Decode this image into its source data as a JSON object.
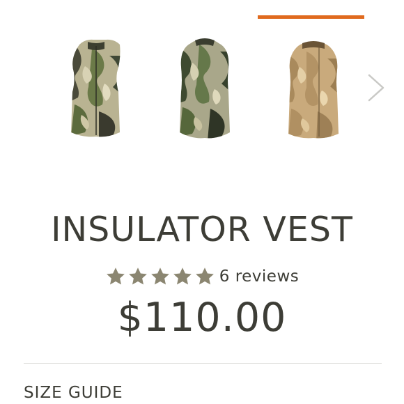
{
  "carousel": {
    "thumbnails": [
      {
        "alt": "Insulator Vest - green camo, front",
        "active": false,
        "pattern": "green-camo"
      },
      {
        "alt": "Insulator Vest - green camo, alternate",
        "active": false,
        "pattern": "green-camo"
      },
      {
        "alt": "Insulator Vest - desert camo",
        "active": true,
        "pattern": "desert-camo"
      }
    ],
    "next_icon": "chevron-right-icon",
    "active_color": "#e06a1e"
  },
  "product": {
    "title": "INSULATOR VEST",
    "rating": 5,
    "rating_max": 5,
    "star_icon": "star-icon",
    "star_color": "#8b8671",
    "reviews_label": "6 reviews",
    "price": "$110.00"
  },
  "size_guide": {
    "label": "SIZE GUIDE"
  }
}
